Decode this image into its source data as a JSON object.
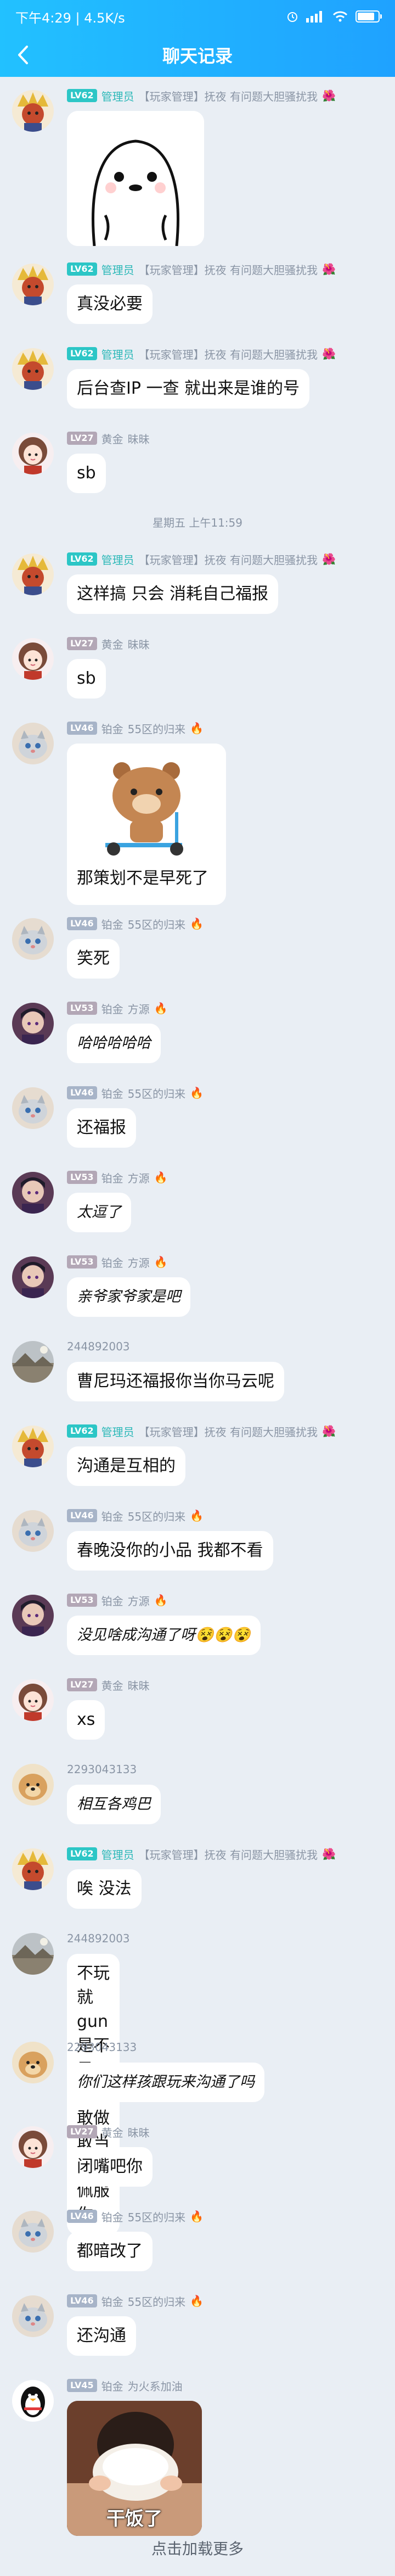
{
  "status": {
    "time_speed": "下午4:29 | 4.5K/s",
    "alarm_icon": "alarm-icon",
    "battery_level": 0.82
  },
  "nav": {
    "title": "聊天记录"
  },
  "divider": {
    "label": "星期五 上午11:59"
  },
  "load_more": "点击加载更多",
  "users": {
    "admin": {
      "level": "LV62",
      "title": "管理员",
      "nick": "【玩家管理】抚夜 有问题大胆骚扰我",
      "emoji": "🌺"
    },
    "meimei": {
      "level": "LV27",
      "title": "黄金",
      "nick": "昧昧"
    },
    "guilai": {
      "level": "LV46",
      "title": "铂金",
      "nick": "55区的归来",
      "emoji": "🔥"
    },
    "fangyuan": {
      "level": "LV53",
      "title": "铂金",
      "nick": "方源",
      "emoji": "🔥"
    },
    "u244892003": {
      "nick": "244892003"
    },
    "u2293043133": {
      "nick": "2293043133"
    },
    "huolong": {
      "level": "LV45",
      "title": "铂金",
      "nick": "为火系加油"
    }
  },
  "messages": [
    {
      "user": "admin",
      "type": "sticker",
      "sticker": "cartoon-character-sticker"
    },
    {
      "user": "admin",
      "text": "真没必要"
    },
    {
      "user": "admin",
      "text": "后台查IP 一查 就出来是谁的号"
    },
    {
      "user": "meimei",
      "text": "sb"
    },
    {
      "user": "admin",
      "text": "这样搞 只会 消耗自己福报"
    },
    {
      "user": "meimei",
      "text": "sb"
    },
    {
      "user": "guilai",
      "text": "那策划不是早死了",
      "sticker": "bear-scooter-sticker"
    },
    {
      "user": "guilai",
      "text": "笑死"
    },
    {
      "user": "fangyuan",
      "text": "哈哈哈哈哈"
    },
    {
      "user": "guilai",
      "text": "还福报"
    },
    {
      "user": "fangyuan",
      "text": "太逗了"
    },
    {
      "user": "fangyuan",
      "text": "亲爷家爷家是吧"
    },
    {
      "user": "u244892003",
      "text": "曹尼玛还福报你当你马云呢"
    },
    {
      "user": "admin",
      "text": "沟通是互相的"
    },
    {
      "user": "guilai",
      "text": "春晚没你的小品 我都不看"
    },
    {
      "user": "fangyuan",
      "text": "没见啥成沟通了呀😵😵😵"
    },
    {
      "user": "meimei",
      "text": "xs"
    },
    {
      "user": "u2293043133",
      "text": "相互各鸡巴"
    },
    {
      "user": "admin",
      "text": "唉 没法"
    },
    {
      "user": "u244892003",
      "text": "不玩就gun是不是你，敢做敢当\n我还佩服你"
    },
    {
      "user": "u2293043133",
      "text": "你们这样孩跟玩来沟通了吗"
    },
    {
      "user": "meimei",
      "text": "闭嘴吧你"
    },
    {
      "user": "guilai",
      "text": "都暗改了"
    },
    {
      "user": "guilai",
      "text": "还沟通"
    },
    {
      "user": "huolong",
      "type": "sticker",
      "sticker": "girl-bowl-sticker",
      "caption": "干饭了"
    }
  ]
}
